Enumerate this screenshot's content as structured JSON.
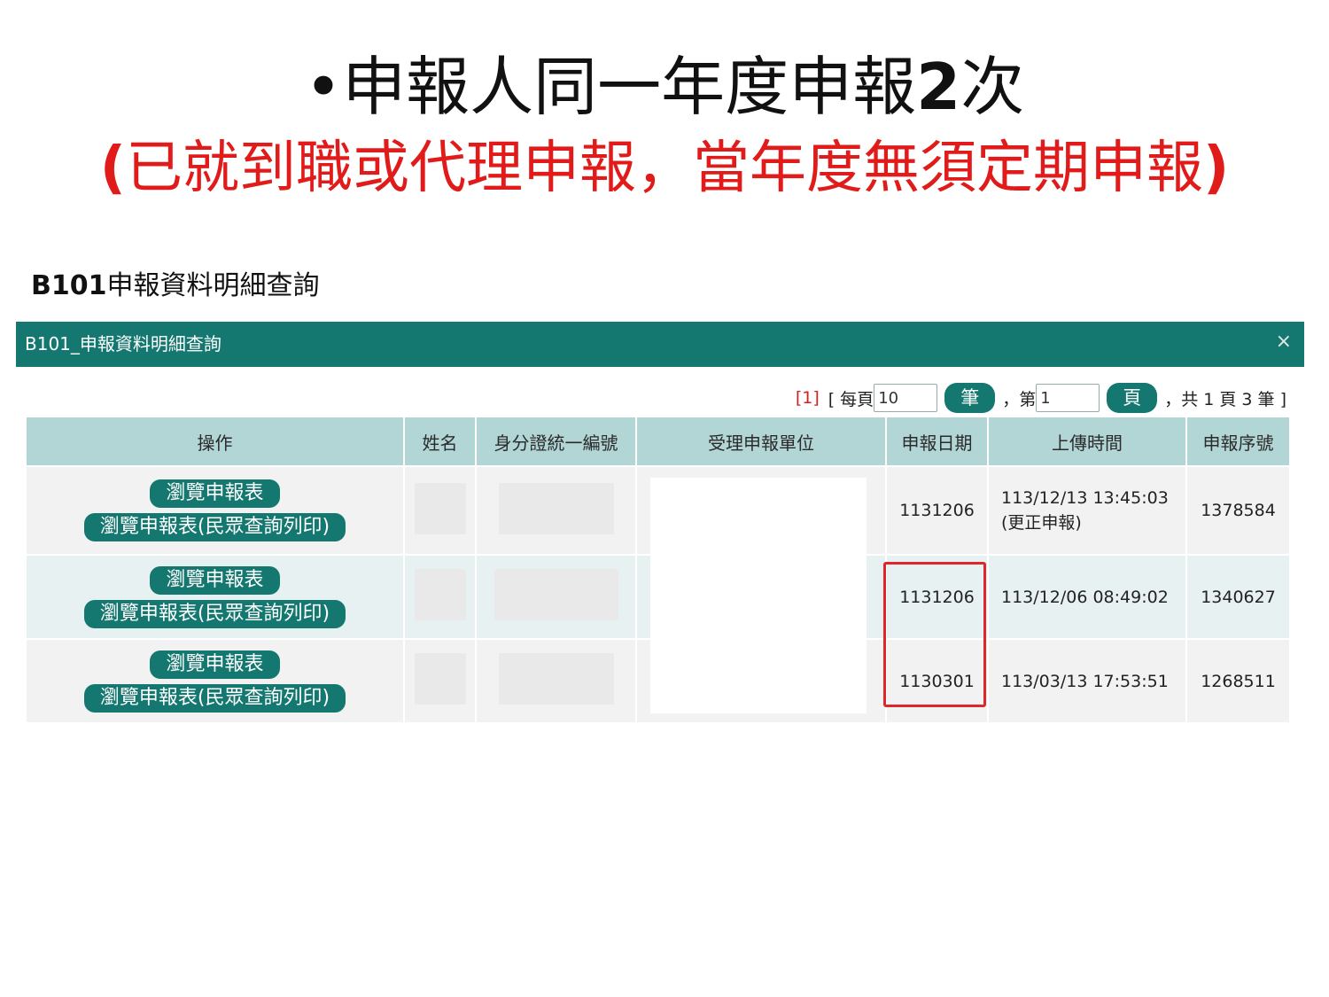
{
  "slide": {
    "title_line1_bullet": "•",
    "title_line1_a": "申報人同一年度申報",
    "title_line1_num": "2",
    "title_line1_b": "次",
    "title_line2_open": "(",
    "title_line2_text": "已就到職或代理申報，當年度無須定期申報",
    "title_line2_close": ")",
    "section_code": "B101",
    "section_text": "申報資料明細查詢"
  },
  "colors": {
    "header_teal": "#147870",
    "table_header": "#b2d5d5",
    "highlight": "#e0262a",
    "title_red": "#e11a1a"
  },
  "dialog": {
    "title": "B101_申報資料明細查詢",
    "close_icon": "×",
    "pager": {
      "current_page_link": "[1]",
      "bracket_open_label": "[ 每頁",
      "per_page_value": "10",
      "per_page_button": "筆",
      "page_label": "，第",
      "page_value": "1",
      "page_button": "頁",
      "summary": "，共 1 頁 3 筆 ]"
    },
    "table": {
      "headers": [
        "操作",
        "姓名",
        "身分證統一編號",
        "受理申報單位",
        "申報日期",
        "上傳時間",
        "申報序號"
      ],
      "rows": [
        {
          "btn_view": "瀏覽申報表",
          "btn_print": "瀏覽申報表(民眾查詢列印)",
          "date": "1131206",
          "upload": "113/12/13 13:45:03 (更正申報)",
          "serial": "1378584"
        },
        {
          "btn_view": "瀏覽申報表",
          "btn_print": "瀏覽申報表(民眾查詢列印)",
          "date": "1131206",
          "upload": "113/12/06 08:49:02",
          "serial": "1340627"
        },
        {
          "btn_view": "瀏覽申報表",
          "btn_print": "瀏覽申報表(民眾查詢列印)",
          "date": "1130301",
          "upload": "113/03/13 17:53:51",
          "serial": "1268511"
        }
      ]
    }
  }
}
